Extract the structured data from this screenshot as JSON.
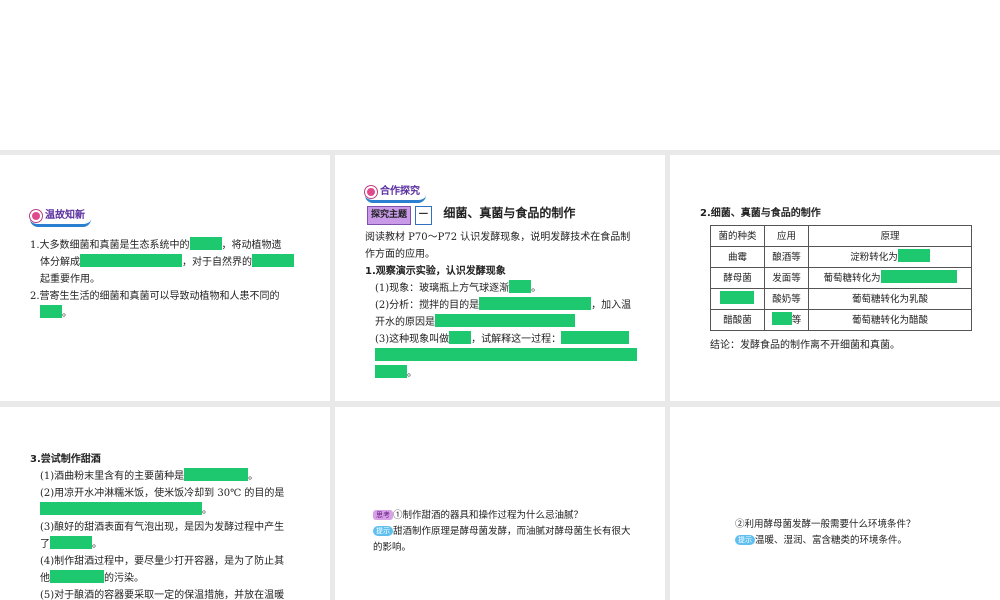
{
  "slide1": {
    "header": "温故知新",
    "l1a": "1.大多数细菌和真菌是生态系统中的",
    "l1b": "，将动植物遗",
    "l1c": "体分解成",
    "l1d": "，对于自然界的",
    "l1e": "起重要作用。",
    "l2a": "2.营寄生生活的细菌和真菌可以导致动植物和人患不同的",
    "l2b": "。"
  },
  "slide2": {
    "header": "合作探究",
    "theme_label": "探究主题",
    "theme_num": "一",
    "title": "细菌、真菌与食品的制作",
    "intro": "阅读教材 P70～P72 认识发酵现象，说明发酵技术在食品制作方面的应用。",
    "h1": "1.观察演示实验，认识发酵现象",
    "p1": "(1)现象：玻璃瓶上方气球逐渐",
    "p2a": "(2)分析：搅拌的目的是",
    "p2b": "，加入温",
    "p2c": "开水的原因是",
    "p3a": "(3)这种现象叫做",
    "p3b": "，试解释这一过程：",
    "dot": "。"
  },
  "slide3": {
    "title": "2.细菌、真菌与食品的制作",
    "headers": [
      "菌的种类",
      "应用",
      "原理"
    ],
    "rows": [
      [
        "曲霉",
        "酿酒等",
        "淀粉转化为"
      ],
      [
        "酵母菌",
        "发面等",
        "葡萄糖转化为"
      ],
      [
        "",
        "酸奶等",
        "葡萄糖转化为乳酸"
      ],
      [
        "醋酸菌",
        "等",
        "葡萄糖转化为醋酸"
      ]
    ],
    "conclusion": "结论：发酵食品的制作离不开细菌和真菌。"
  },
  "slide4": {
    "title": "3.尝试制作甜酒",
    "p1": "(1)酒曲粉末里含有的主要菌种是",
    "p2": "(2)用凉开水冲淋糯米饭，使米饭冷却到 30℃ 的目的是",
    "p3a": "(3)酿好的甜酒表面有气泡出现，是因为发酵过程中产生",
    "p3b": "了",
    "p4a": "(4)制作甜酒过程中，要尽量少打开容器，是为了防止其",
    "p4b": "他",
    "p4c": "的污染。",
    "p5": "(5)对于酿酒的容器要采取一定的保温措施，并放在温暖",
    "dot": "。"
  },
  "slide5": {
    "think_tag": "思考",
    "question": "①制作甜酒的器具和操作过程为什么忌油腻？",
    "tip_tag": "提示",
    "answer": "甜酒制作原理是酵母菌发酵，而油腻对酵母菌生长有很大的影响。"
  },
  "slide6": {
    "question": "②利用酵母菌发酵一般需要什么环境条件？",
    "tip_tag": "提示",
    "answer": "温暖、湿润、富含糖类的环境条件。"
  },
  "colors": {
    "blank": "#1ec86e",
    "gap": "#e9e9e9"
  }
}
